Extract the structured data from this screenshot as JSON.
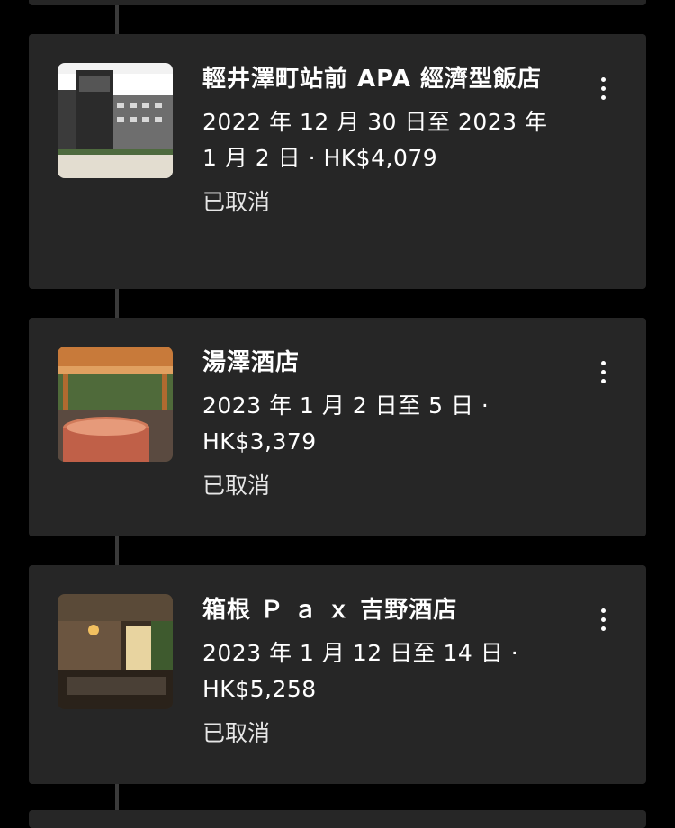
{
  "bookings": [
    {
      "name": "輕井澤町站前 APA 經濟型飯店",
      "stay": "2022 年 12 月 30 日至 2023 年 1 月 2 日 · HK$4,079",
      "status": "已取消"
    },
    {
      "name": "湯澤酒店",
      "stay": "2023 年 1 月 2 日至 5 日 · HK$3,379",
      "status": "已取消"
    },
    {
      "name": "箱根 Ｐ ａ ｘ 吉野酒店",
      "stay": "2023 年 1 月 12 日至 14 日 · HK$5,258",
      "status": "已取消"
    }
  ],
  "icons": {
    "more": "more-vertical-icon"
  },
  "colors": {
    "background": "#000000",
    "card": "#262626",
    "timeline": "#3a3a3a",
    "text": "#ffffff"
  }
}
